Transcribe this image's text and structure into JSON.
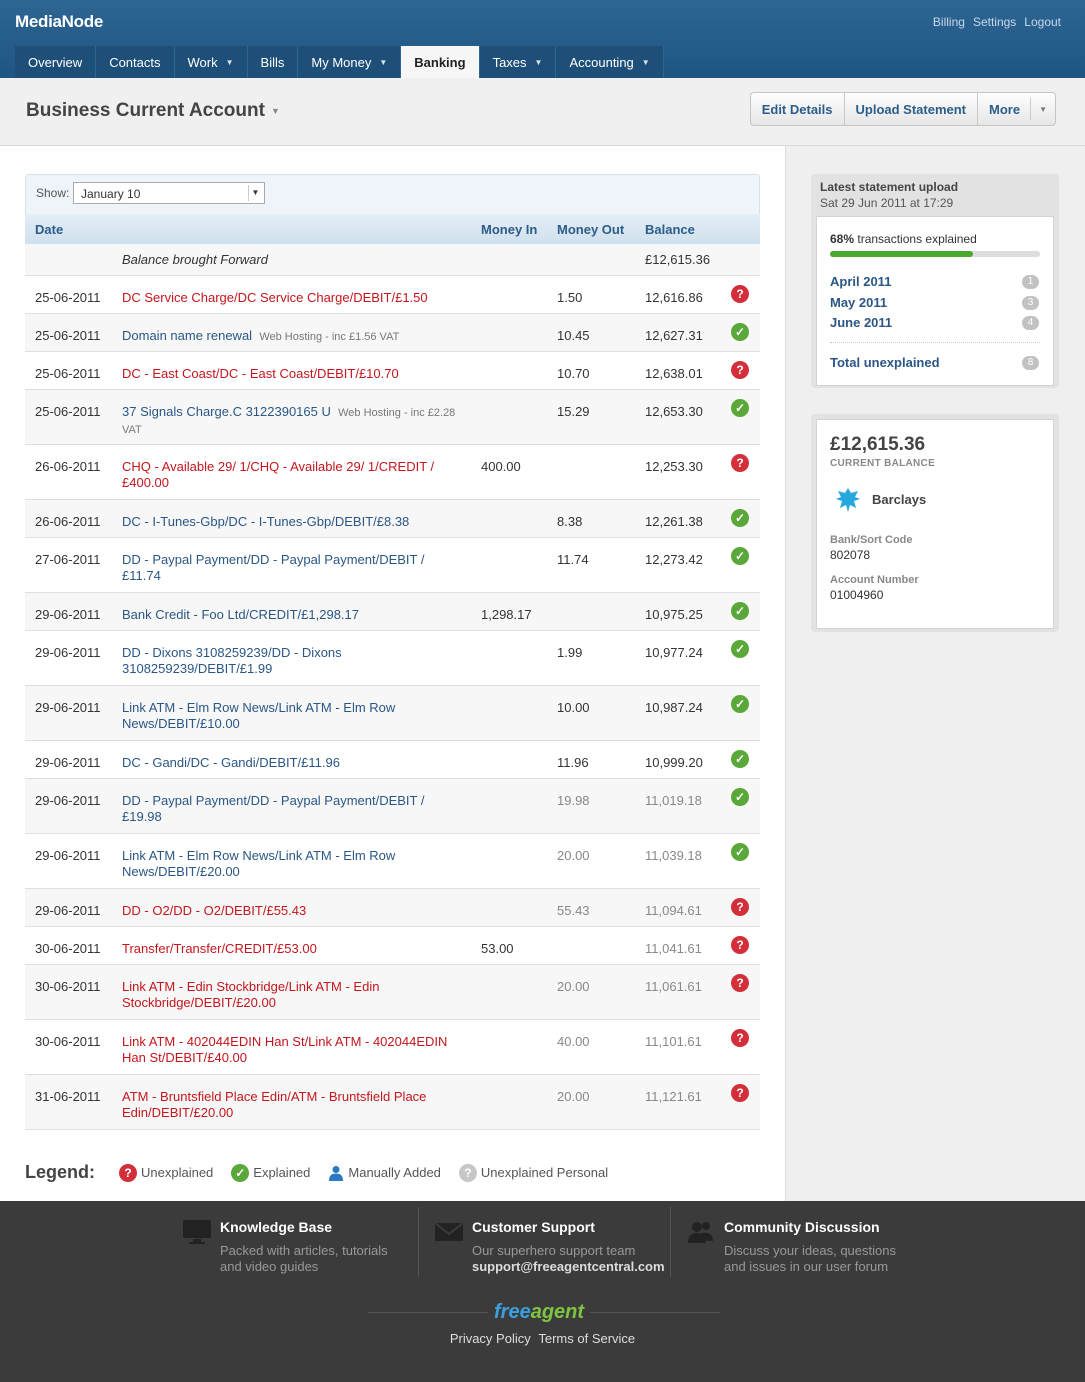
{
  "app": {
    "brand": "MediaNode",
    "top_links": [
      "Billing",
      "Settings",
      "Logout"
    ]
  },
  "nav": {
    "tabs": [
      {
        "label": "Overview",
        "dropdown": false
      },
      {
        "label": "Contacts",
        "dropdown": false
      },
      {
        "label": "Work",
        "dropdown": true
      },
      {
        "label": "Bills",
        "dropdown": false
      },
      {
        "label": "My Money",
        "dropdown": true
      },
      {
        "label": "Banking",
        "dropdown": false,
        "active": true
      },
      {
        "label": "Taxes",
        "dropdown": true
      },
      {
        "label": "Accounting",
        "dropdown": true
      }
    ]
  },
  "titlebar": {
    "account_title": "Business Current Account",
    "buttons": {
      "edit": "Edit Details",
      "upload": "Upload Statement",
      "more": "More"
    }
  },
  "filter": {
    "show_label": "Show:",
    "selected": "January 10"
  },
  "table": {
    "headers": {
      "date": "Date",
      "money_in": "Money In",
      "money_out": "Money Out",
      "balance": "Balance"
    },
    "rows": [
      {
        "date": "",
        "desc": "Balance brought Forward",
        "note": "",
        "in": "",
        "out": "",
        "balance": "£12,615.36",
        "status": "none",
        "style": "plain"
      },
      {
        "date": "25-06-2011",
        "desc": "DC Service Charge/DC Service Charge/DEBIT/£1.50",
        "note": "",
        "in": "",
        "out": "1.50",
        "balance": "12,616.86",
        "status": "unexplained",
        "style": "red"
      },
      {
        "date": "25-06-2011",
        "desc": "Domain name renewal",
        "note": "Web Hosting - inc £1.56 VAT",
        "in": "",
        "out": "10.45",
        "balance": "12,627.31",
        "status": "explained",
        "style": "blue"
      },
      {
        "date": "25-06-2011",
        "desc": "DC - East Coast/DC - East Coast/DEBIT/£10.70",
        "note": "",
        "in": "",
        "out": "10.70",
        "balance": "12,638.01",
        "status": "unexplained",
        "style": "red"
      },
      {
        "date": "25-06-2011",
        "desc": "37 Signals Charge.C 3122390165 U",
        "note": "Web Hosting - inc £2.28 VAT",
        "in": "",
        "out": "15.29",
        "balance": "12,653.30",
        "status": "explained",
        "style": "blue"
      },
      {
        "date": "26-06-2011",
        "desc": "CHQ - Available 29/ 1/CHQ - Available 29/ 1/CREDIT /£400.00",
        "note": "",
        "in": "400.00",
        "out": "",
        "balance": "12,253.30",
        "status": "unexplained",
        "style": "red"
      },
      {
        "date": "26-06-2011",
        "desc": "DC - I-Tunes-Gbp/DC - I-Tunes-Gbp/DEBIT/£8.38",
        "note": "",
        "in": "",
        "out": "8.38",
        "balance": "12,261.38",
        "status": "explained",
        "style": "blue"
      },
      {
        "date": "27-06-2011",
        "desc": "DD - Paypal Payment/DD - Paypal Payment/DEBIT /£11.74",
        "note": "",
        "in": "",
        "out": "11.74",
        "balance": "12,273.42",
        "status": "explained",
        "style": "blue"
      },
      {
        "date": "29-06-2011",
        "desc": "Bank Credit - Foo Ltd/CREDIT/£1,298.17",
        "note": "",
        "in": "1,298.17",
        "out": "",
        "balance": "10,975.25",
        "status": "explained",
        "style": "blue"
      },
      {
        "date": "29-06-2011",
        "desc": "DD - Dixons 3108259239/DD - Dixons 3108259239/DEBIT/£1.99",
        "note": "",
        "in": "",
        "out": "1.99",
        "balance": "10,977.24",
        "status": "explained",
        "style": "blue"
      },
      {
        "date": "29-06-2011",
        "desc": "Link ATM - Elm Row News/Link ATM - Elm Row News/DEBIT/£10.00",
        "note": "",
        "in": "",
        "out": "10.00",
        "balance": "10,987.24",
        "status": "explained",
        "style": "blue"
      },
      {
        "date": "29-06-2011",
        "desc": "DC - Gandi/DC - Gandi/DEBIT/£11.96",
        "note": "",
        "in": "",
        "out": "11.96",
        "balance": "10,999.20",
        "status": "explained",
        "style": "blue"
      },
      {
        "date": "29-06-2011",
        "desc": "DD - Paypal Payment/DD - Paypal Payment/DEBIT /£19.98",
        "note": "",
        "in": "",
        "out": "19.98",
        "balance": "11,019.18",
        "status": "explained",
        "style": "blue",
        "grey": true
      },
      {
        "date": "29-06-2011",
        "desc": "Link ATM - Elm Row News/Link ATM - Elm Row News/DEBIT/£20.00",
        "note": "",
        "in": "",
        "out": "20.00",
        "balance": "11,039.18",
        "status": "explained",
        "style": "blue",
        "grey": true
      },
      {
        "date": "29-06-2011",
        "desc": "DD - O2/DD - O2/DEBIT/£55.43",
        "note": "",
        "in": "",
        "out": "55.43",
        "balance": "11,094.61",
        "status": "unexplained",
        "style": "red",
        "grey": true
      },
      {
        "date": "30-06-2011",
        "desc": "Transfer/Transfer/CREDIT/£53.00",
        "note": "",
        "in": "53.00",
        "out": "",
        "balance": "11,041.61",
        "status": "unexplained",
        "style": "red",
        "grey": true
      },
      {
        "date": "30-06-2011",
        "desc": "Link ATM - Edin Stockbridge/Link ATM - Edin Stockbridge/DEBIT/£20.00",
        "note": "",
        "in": "",
        "out": "20.00",
        "balance": "11,061.61",
        "status": "unexplained",
        "style": "red",
        "grey": true
      },
      {
        "date": "30-06-2011",
        "desc": "Link ATM - 402044EDIN Han St/Link ATM - 402044EDIN Han St/DEBIT/£40.00",
        "note": "",
        "in": "",
        "out": "40.00",
        "balance": "11,101.61",
        "status": "unexplained",
        "style": "red",
        "grey": true
      },
      {
        "date": "31-06-2011",
        "desc": "ATM - Bruntsfield Place Edin/ATM - Bruntsfield Place Edin/DEBIT/£20.00",
        "note": "",
        "in": "",
        "out": "20.00",
        "balance": "11,121.61",
        "status": "unexplained",
        "style": "red",
        "grey": true
      }
    ]
  },
  "legend": {
    "title": "Legend:",
    "items": [
      {
        "label": "Unexplained",
        "icon": "question-icon"
      },
      {
        "label": "Explained",
        "icon": "check-icon"
      },
      {
        "label": "Manually Added",
        "icon": "person-icon"
      },
      {
        "label": "Unexplained Personal",
        "icon": "grey-question-icon"
      }
    ]
  },
  "statement": {
    "title": "Latest statement upload",
    "date": "Sat 29 Jun 2011 at 17:29",
    "explained_pct": "68%",
    "explained_text": "transactions explained",
    "progress": 0.68,
    "months": [
      {
        "label": "April 2011",
        "count": "1"
      },
      {
        "label": "May 2011",
        "count": "3"
      },
      {
        "label": "June 2011",
        "count": "4"
      }
    ],
    "total_label": "Total unexplained",
    "total_count": "8"
  },
  "account": {
    "balance": "£12,615.36",
    "balance_label": "CURRENT BALANCE",
    "bank": "Barclays",
    "sort_label": "Bank/Sort Code",
    "sort_code": "802078",
    "acct_label": "Account Number",
    "acct_number": "01004960"
  },
  "footer": {
    "cols": [
      {
        "title": "Knowledge Base",
        "line1": "Packed with articles, tutorials",
        "line2": "and video guides"
      },
      {
        "title": "Customer Support",
        "line1": "Our superhero support team",
        "line2": "support@freeagentcentral.com"
      },
      {
        "title": "Community Discussion",
        "line1": "Discuss your ideas, questions",
        "line2": "and issues in our user forum"
      }
    ],
    "logo_a": "free",
    "logo_b": "agent",
    "links": [
      "Privacy Policy",
      "Terms of Service"
    ]
  },
  "colors": {
    "header": "#1f5582",
    "explained": "#5aa83a",
    "unexplained": "#d32f3a",
    "link": "#2a5786"
  }
}
